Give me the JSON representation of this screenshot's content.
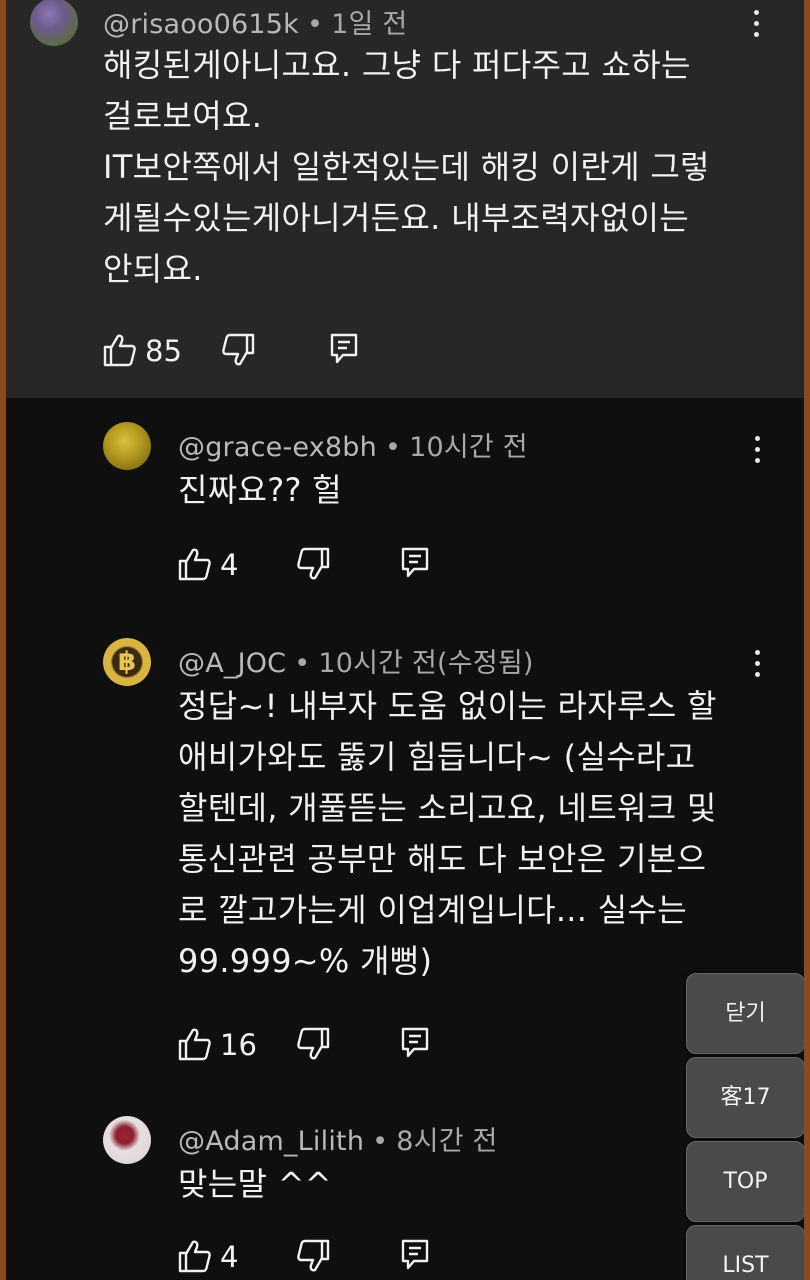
{
  "comments": [
    {
      "handle": "@risaoo0615k",
      "time": "1일 전",
      "text": "해킹된게아니고요. 그냥 다 퍼다주고 쇼하는\n걸로보여요.\nIT보안쪽에서 일한적있는데 해킹 이란게 그렇\n게될수있는게아니거든요. 내부조력자없이는\n안되요.",
      "likes": "85",
      "avatar_colors": [
        "#6e5a8c",
        "#5d6b4a"
      ]
    },
    {
      "handle": "@grace-ex8bh",
      "time": "10시간 전",
      "text": "진짜요?? 헐",
      "likes": "4",
      "avatar_colors": [
        "#b59a1e",
        "#6b5a10"
      ]
    },
    {
      "handle": "@A_JOC",
      "time": "10시간 전(수정됨)",
      "text": "정답~! 내부자 도움 없이는 라자루스 할\n애비가와도 뚫기 힘듭니다~ (실수라고\n할텐데, 개풀뜯는 소리고요, 네트워크 및\n통신관련 공부만 해도 다 보안은 기본으\n로 깔고가는게 이업계입니다... 실수는\n99.999~% 개뻥)",
      "likes": "16",
      "avatar_colors": [
        "#d9b440",
        "#2a2a2a"
      ],
      "avatar_glyph": "B"
    },
    {
      "handle": "@Adam_Lilith",
      "time": "8시간 전",
      "text": "맞는말 ^^",
      "likes": "4",
      "avatar_colors": [
        "#e8e0e0",
        "#a0202a"
      ]
    }
  ],
  "icons": {
    "like": "thumb-up-icon",
    "dislike": "thumb-down-icon",
    "reply": "reply-icon",
    "more": "more-vert-icon"
  },
  "floating_buttons": {
    "close": "닫기",
    "count": "客17",
    "top": "TOP",
    "list": "LIST"
  }
}
